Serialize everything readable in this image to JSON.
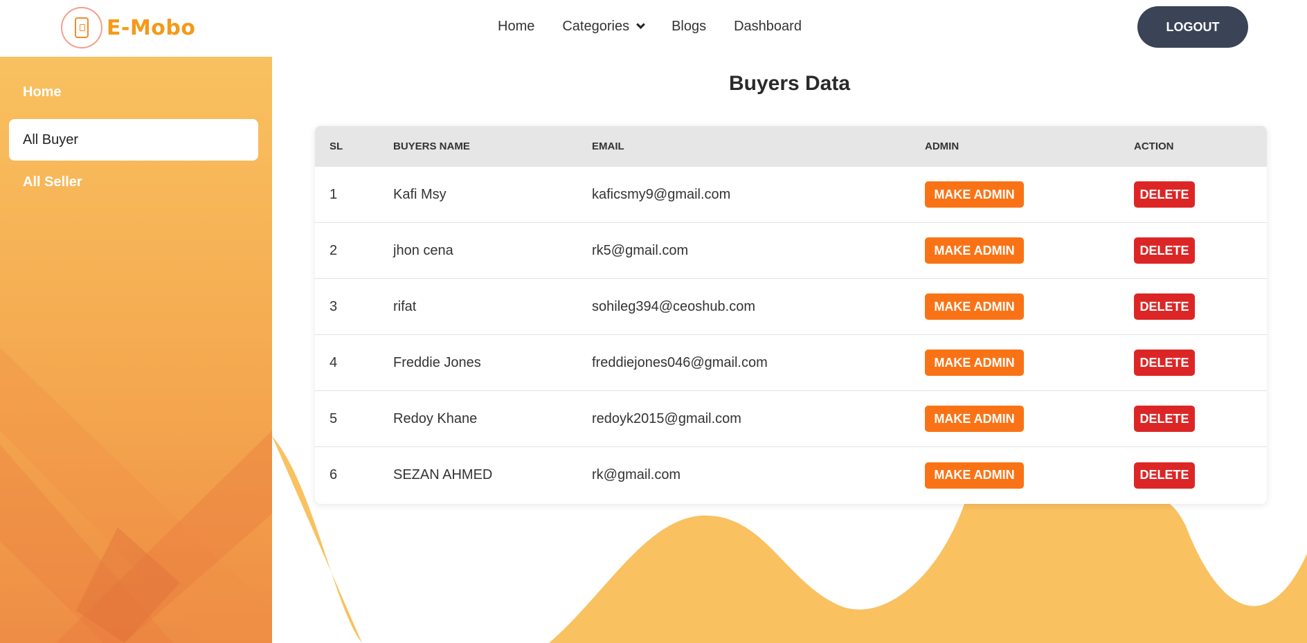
{
  "brand": {
    "name": "E-Mobo",
    "logo_icon": "phone-icon"
  },
  "nav": {
    "items": [
      {
        "label": "Home"
      },
      {
        "label": "Categories",
        "icon": "chevron-down-icon"
      },
      {
        "label": "Blogs"
      },
      {
        "label": "Dashboard"
      }
    ],
    "logout_label": "LOGOUT"
  },
  "sidebar": {
    "home": "Home",
    "all_buyer": "All Buyer",
    "all_seller": "All Seller"
  },
  "page": {
    "title": "Buyers Data"
  },
  "table": {
    "headers": {
      "sl": "SL",
      "name": "BUYERS NAME",
      "email": "EMAIL",
      "admin": "ADMIN",
      "action": "ACTION"
    },
    "make_admin_label": "MAKE ADMIN",
    "delete_label": "DELETE",
    "rows": [
      {
        "sl": "1",
        "name": "Kafi Msy",
        "email": "kaficsmy9@gmail.com"
      },
      {
        "sl": "2",
        "name": "jhon cena",
        "email": "rk5@gmail.com"
      },
      {
        "sl": "3",
        "name": "rifat",
        "email": "sohileg394@ceoshub.com"
      },
      {
        "sl": "4",
        "name": "Freddie Jones",
        "email": "freddiejones046@gmail.com"
      },
      {
        "sl": "5",
        "name": "Redoy Khane",
        "email": "redoyk2015@gmail.com"
      },
      {
        "sl": "6",
        "name": "SEZAN AHMED",
        "email": "rk@gmail.com"
      }
    ]
  },
  "colors": {
    "brand_orange": "#f39a1a",
    "make_admin": "#f97316",
    "delete": "#dc2626",
    "logout_bg": "#3b4356",
    "sidebar_top": "#f9c160",
    "wave": "#f9c160"
  }
}
